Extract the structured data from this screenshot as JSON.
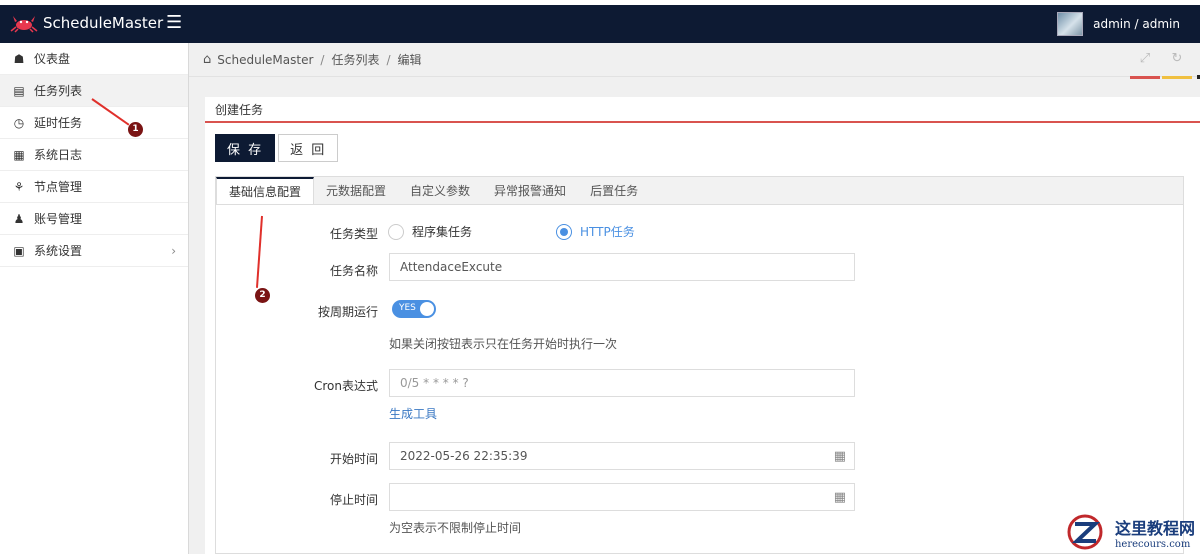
{
  "app": {
    "title": "ScheduleMaster",
    "menu_icon": "hamburger-icon"
  },
  "user": {
    "name": "admin / admin"
  },
  "sidebar": {
    "items": [
      {
        "label": "仪表盘",
        "icon": "home-icon"
      },
      {
        "label": "任务列表",
        "icon": "list-icon"
      },
      {
        "label": "延时任务",
        "icon": "clock-icon"
      },
      {
        "label": "系统日志",
        "icon": "grid-icon"
      },
      {
        "label": "节点管理",
        "icon": "sitemap-icon"
      },
      {
        "label": "账号管理",
        "icon": "user-icon"
      },
      {
        "label": "系统设置",
        "icon": "monitor-icon",
        "caret": "›"
      }
    ]
  },
  "breadcrumb": {
    "items": [
      "ScheduleMaster",
      "任务列表",
      "编辑"
    ],
    "separator": "/"
  },
  "panel": {
    "title": "创建任务",
    "accent": "#d9534f"
  },
  "buttons": {
    "save": "保 存",
    "back": "返 回"
  },
  "tabs": [
    "基础信息配置",
    "元数据配置",
    "自定义参数",
    "异常报警通知",
    "后置任务"
  ],
  "form": {
    "task_type_label": "任务类型",
    "task_type_options": [
      "程序集任务",
      "HTTP任务"
    ],
    "task_type_selected": "HTTP任务",
    "task_name_label": "任务名称",
    "task_name_value": "AttendaceExcute",
    "periodic_label": "按周期运行",
    "periodic_toggle": "YES",
    "periodic_help": "如果关闭按钮表示只在任务开始时执行一次",
    "cron_label": "Cron表达式",
    "cron_placeholder": "0/5 * * * * ?",
    "cron_tool_link": "生成工具",
    "start_label": "开始时间",
    "start_value": "2022-05-26 22:35:39",
    "stop_label": "停止时间",
    "stop_value": "",
    "stop_help": "为空表示不限制停止时间"
  },
  "annotations": [
    "1",
    "2"
  ],
  "watermark": {
    "cn": "这里教程网",
    "en": "herecours.com"
  },
  "colors": {
    "nav_bg": "#0d1a33",
    "accent_red": "#d9534f",
    "accent_yellow": "#f0c040",
    "link_blue": "#3a78c3",
    "toggle_blue": "#4a90e2"
  }
}
